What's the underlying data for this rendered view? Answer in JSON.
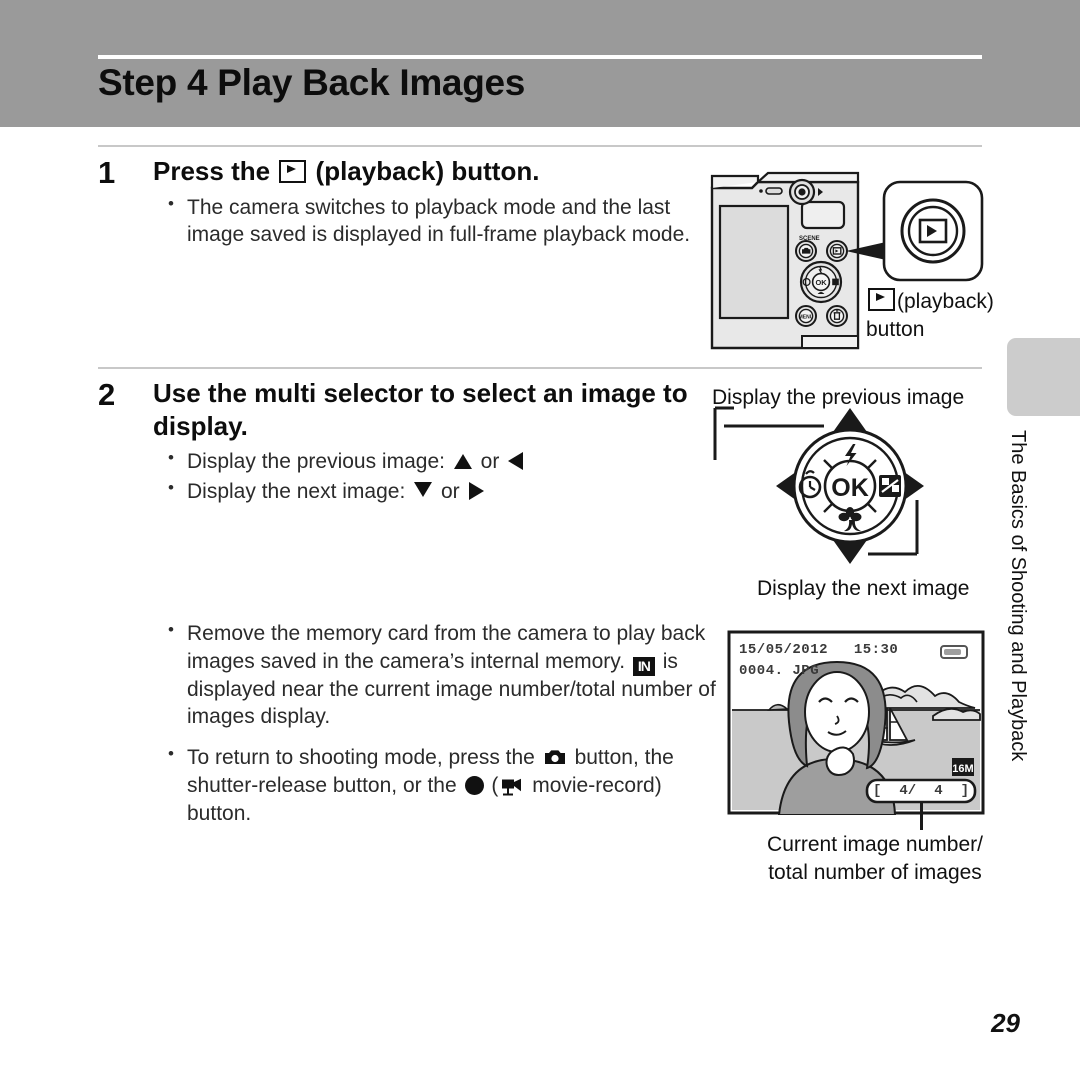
{
  "header": {
    "title": "Step 4 Play Back Images"
  },
  "side_tab": {
    "chapter_label": "The Basics of Shooting and Playback"
  },
  "steps": [
    {
      "number": "1",
      "heading_before": "Press the",
      "heading_icon": "playback-icon",
      "heading_after": "(playback) button.",
      "bullets": [
        "The camera switches to playback mode and the last image saved is displayed in full-frame playback mode."
      ]
    },
    {
      "number": "2",
      "heading": "Use the multi selector to select an image to display.",
      "bullets": [
        {
          "text_before": "Display the previous image:",
          "icon_a": "triangle-up-icon",
          "separator": "or",
          "icon_b": "triangle-left-icon"
        },
        {
          "text_before": "Display the next image:",
          "icon_a": "triangle-down-icon",
          "separator": "or",
          "icon_b": "triangle-right-icon"
        }
      ]
    }
  ],
  "notes": [
    {
      "part1": "Remove the memory card from the camera to play back images saved in the camera’s internal memory.",
      "icon": "internal-memory-icon",
      "part2": "is displayed near the current image number/total number of images display."
    },
    {
      "part1": "To return to shooting mode, press the",
      "icon1": "camera-icon",
      "part2": "button, the shutter-release button, or the",
      "icon2": "record-dot-icon",
      "part3": "(",
      "icon3": "movie-camera-icon",
      "part4": "movie-record) button."
    }
  ],
  "figures": {
    "camera_back": {
      "caption_icon": "playback-icon",
      "caption_line1": "(playback)",
      "caption_line2": "button",
      "button_labels": {
        "mode": "camera-mode-button",
        "playback": "playback-button",
        "menu": "MENU",
        "delete": "delete-button",
        "ok": "OK"
      }
    },
    "multi_selector": {
      "caption_previous": "Display the previous image",
      "caption_next": "Display the next image",
      "center_label": "OK",
      "dial_icons": {
        "top": "flash-icon",
        "left": "self-timer-icon",
        "right": "exposure-compensation-icon",
        "bottom": "macro-flower-icon"
      }
    },
    "lcd": {
      "date": "15/05/2012",
      "time": "15:30",
      "filename": "0004. JPG",
      "battery_icon": "battery-icon",
      "image_size": "16M",
      "counter_open": "[",
      "counter_current": "4/",
      "counter_total": "4",
      "counter_close": "]",
      "caption_line1": "Current image number/",
      "caption_line2": "total number of images"
    }
  },
  "page_number": "29",
  "colors": {
    "header_band": "#9a9a9a",
    "side_tab": "#cccccc",
    "rule": "#c8c8c8",
    "text": "#1a1a1a"
  }
}
